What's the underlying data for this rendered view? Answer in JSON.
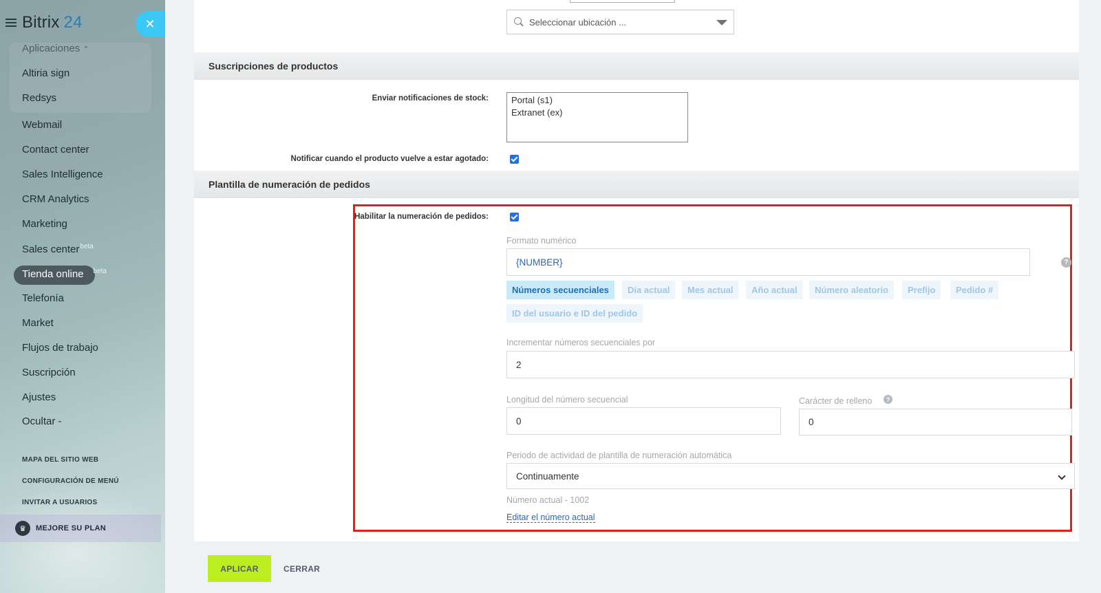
{
  "sidebar": {
    "logo": {
      "name": "Bitrix",
      "number": "24"
    },
    "apps_header": "Aplicaciones",
    "app_items": [
      "Altiria sign",
      "Redsys"
    ],
    "items": [
      {
        "label": "Webmail"
      },
      {
        "label": "Contact center"
      },
      {
        "label": "Sales Intelligence"
      },
      {
        "label": "CRM Analytics"
      },
      {
        "label": "Marketing"
      },
      {
        "label": "Sales center",
        "badge": "beta"
      },
      {
        "label": "Tienda online",
        "badge": "beta"
      },
      {
        "label": "Telefonía"
      },
      {
        "label": "Market"
      },
      {
        "label": "Flujos de trabajo"
      },
      {
        "label": "Suscripción"
      },
      {
        "label": "Ajustes"
      },
      {
        "label": "Ocultar -"
      }
    ],
    "links": [
      "MAPA DEL SITIO WEB",
      "CONFIGURACIÓN DE MENÚ",
      "INVITAR A USUARIOS"
    ],
    "upgrade": "MEJORE SU PLAN"
  },
  "form": {
    "location_placeholder": "Seleccionar ubicación ...",
    "subscriptions": {
      "title": "Suscripciones de productos",
      "stock_label": "Enviar notificaciones de stock:",
      "stock_options": [
        "Portal (s1)",
        "Extranet (ex)"
      ],
      "notify_label": "Notificar cuando el producto vuelve a estar agotado:",
      "notify_checked": true
    },
    "numbering": {
      "title": "Plantilla de numeración de pedidos",
      "enable_label": "Habilitar la numeración de pedidos:",
      "enable_checked": true,
      "format_label": "Formato numérico",
      "format_value": "{NUMBER}",
      "chips": [
        "Números secuenciales",
        "Día actual",
        "Mes actual",
        "Año actual",
        "Número aleatorio",
        "Prefijo",
        "Pedido #",
        "ID del usuario e ID del pedido"
      ],
      "active_chip": "Números secuenciales",
      "increment_label": "Incrementar números secuenciales por",
      "increment_value": "2",
      "length_label": "Longitud del número secuencial",
      "length_value": "0",
      "fill_label": "Carácter de relleno",
      "fill_value": "0",
      "period_label": "Periodo de actividad de plantilla de numeración automática",
      "period_value": "Continuamente",
      "current_number": "Número actual - 1002",
      "edit_link": "Editar el número actual"
    }
  },
  "footer": {
    "apply": "APLICAR",
    "close": "CERRAR"
  },
  "colors": {
    "accent": "#bbed21",
    "highlight_border": "#e0201b",
    "link": "#2a67b3",
    "sidebar_close": "#3bc8f5"
  }
}
